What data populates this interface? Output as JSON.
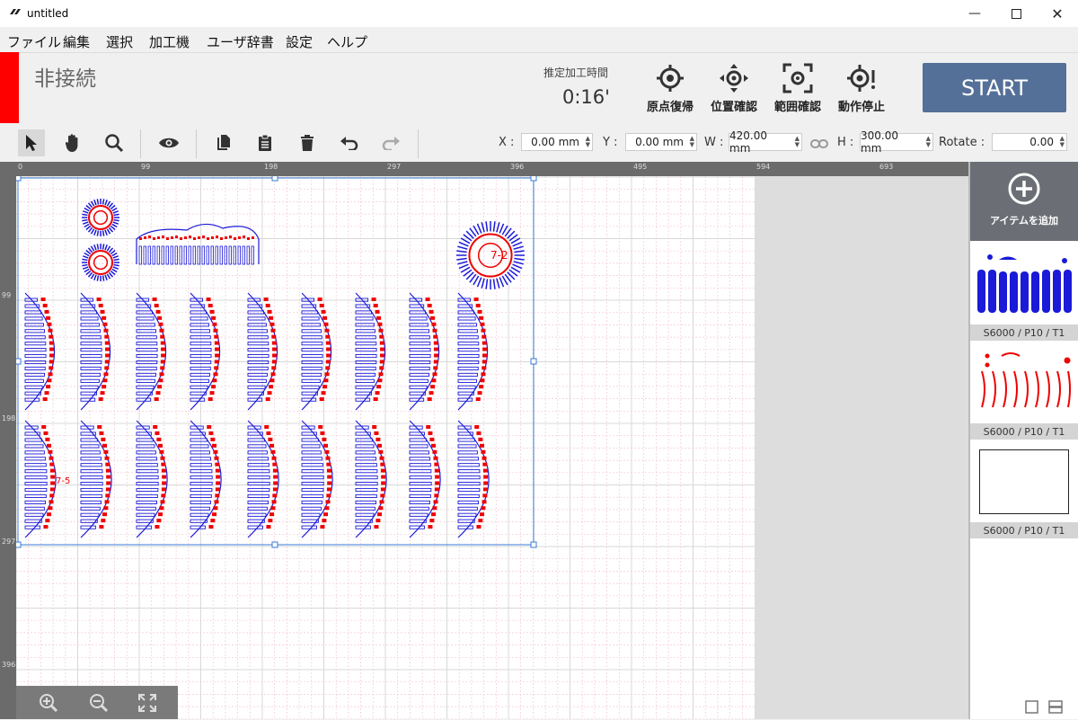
{
  "window": {
    "title": "untitled"
  },
  "menu": [
    "ファイル",
    "編集",
    "選択",
    "加工機",
    "ユーザ辞書",
    "設定",
    "ヘルプ"
  ],
  "status": {
    "connection": "非接続",
    "connection_color": "#ff0000",
    "estimate_label": "推定加工時間",
    "estimate_value": "0:16'"
  },
  "actions": [
    {
      "label": "原点復帰",
      "icon": "origin-return-icon"
    },
    {
      "label": "位置確認",
      "icon": "position-check-icon"
    },
    {
      "label": "範囲確認",
      "icon": "range-check-icon"
    },
    {
      "label": "動作停止",
      "icon": "stop-operation-icon"
    }
  ],
  "start": {
    "label": "START",
    "color": "#557098"
  },
  "coords": {
    "x_label": "X :",
    "x_value": "0.00 mm",
    "y_label": "Y :",
    "y_value": "0.00 mm",
    "w_label": "W :",
    "w_value": "420.00 mm",
    "h_label": "H :",
    "h_value": "300.00 mm",
    "rotate_label": "Rotate :",
    "rotate_value": "0.00"
  },
  "ruler_top": [
    "0",
    "99",
    "198",
    "297",
    "396",
    "495",
    "594",
    "693"
  ],
  "ruler_left": [
    "99",
    "198",
    "297",
    "396"
  ],
  "artwork": {
    "stem_labels": [
      "7-2",
      "7-5"
    ]
  },
  "side_panel": {
    "add_label": "アイテムを追加",
    "items": [
      {
        "label": "S6000 / P10 / T1"
      },
      {
        "label": "S6000 / P10 / T1"
      },
      {
        "label": "S6000 / P10 / T1"
      }
    ]
  }
}
